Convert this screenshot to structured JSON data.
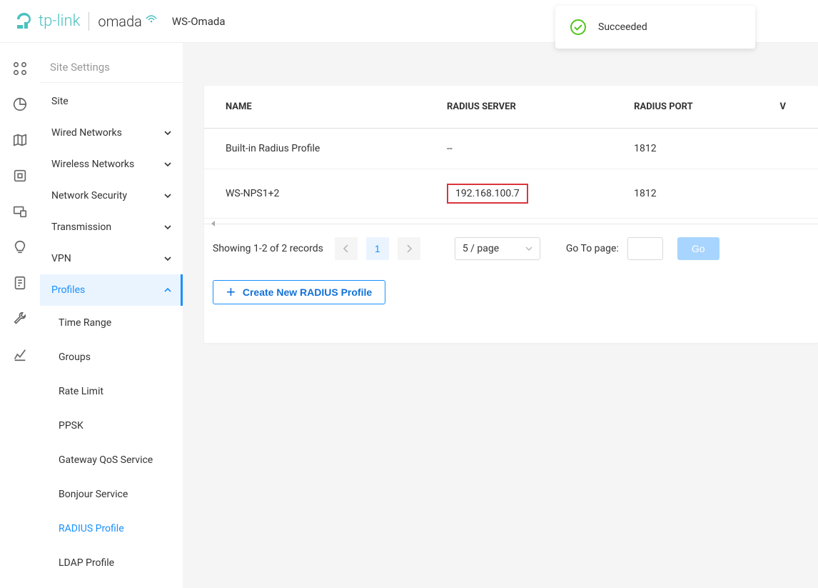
{
  "header": {
    "brand1": "tp-link",
    "brand2": "omada",
    "site_name": "WS-Omada"
  },
  "toast": {
    "text": "Succeeded"
  },
  "sidebar": {
    "section_title": "Site Settings",
    "items": [
      {
        "label": "Site",
        "expandable": false
      },
      {
        "label": "Wired Networks",
        "expandable": true
      },
      {
        "label": "Wireless Networks",
        "expandable": true
      },
      {
        "label": "Network Security",
        "expandable": true
      },
      {
        "label": "Transmission",
        "expandable": true
      },
      {
        "label": "VPN",
        "expandable": true
      },
      {
        "label": "Profiles",
        "expandable": true,
        "active": true
      }
    ],
    "profiles_submenu": [
      {
        "label": "Time Range"
      },
      {
        "label": "Groups"
      },
      {
        "label": "Rate Limit"
      },
      {
        "label": "PPSK"
      },
      {
        "label": "Gateway QoS Service"
      },
      {
        "label": "Bonjour Service"
      },
      {
        "label": "RADIUS Profile",
        "active": true
      },
      {
        "label": "LDAP Profile"
      }
    ]
  },
  "table": {
    "columns": [
      "NAME",
      "RADIUS SERVER",
      "RADIUS PORT",
      "V"
    ],
    "rows": [
      {
        "name": "Built-in Radius Profile",
        "server": "--",
        "port": "1812",
        "highlight": false
      },
      {
        "name": "WS-NPS1+2",
        "server": "192.168.100.7",
        "port": "1812",
        "highlight": true
      }
    ]
  },
  "pagination": {
    "info": "Showing 1-2 of 2 records",
    "page": "1",
    "page_size": "5 / page",
    "goto_label": "Go To page:",
    "go_button": "Go"
  },
  "create_button": "Create New RADIUS Profile"
}
